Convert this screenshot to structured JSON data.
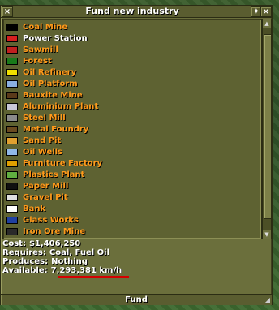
{
  "window": {
    "title": "Fund new industry",
    "close_icon": "close-x",
    "pin_icon": "pin",
    "fund_label": "Fund"
  },
  "industries": [
    {
      "label": "Coal Mine",
      "color": "#000000"
    },
    {
      "label": "Power Station",
      "color": "#d42020",
      "selected": true
    },
    {
      "label": "Sawmill",
      "color": "#c02020"
    },
    {
      "label": "Forest",
      "color": "#1a7a1a"
    },
    {
      "label": "Oil Refinery",
      "color": "#f0e000"
    },
    {
      "label": "Oil Platform",
      "color": "#8ab0e0"
    },
    {
      "label": "Bauxite Mine",
      "color": "#5a3a1a"
    },
    {
      "label": "Aluminium Plant",
      "color": "#c8c8d8"
    },
    {
      "label": "Steel Mill",
      "color": "#8a8a8a"
    },
    {
      "label": "Metal Foundry",
      "color": "#6a4a20"
    },
    {
      "label": "Sand Pit",
      "color": "#e0a030"
    },
    {
      "label": "Oil Wells",
      "color": "#90b8e8"
    },
    {
      "label": "Furniture Factory",
      "color": "#e0a000"
    },
    {
      "label": "Plastics Plant",
      "color": "#60b040"
    },
    {
      "label": "Paper Mill",
      "color": "#101010"
    },
    {
      "label": "Gravel Pit",
      "color": "#e0e0e0"
    },
    {
      "label": "Bank",
      "color": "#ffffff"
    },
    {
      "label": "Glass Works",
      "color": "#2040a0"
    },
    {
      "label": "Iron Ore Mine",
      "color": "#2a2a2a"
    }
  ],
  "info": {
    "cost_label": "Cost:",
    "cost_value": "$1,406,250",
    "requires_label": "Requires:",
    "requires_value": "Coal, Fuel Oil",
    "produces_label": "Produces:",
    "produces_value": "Nothing",
    "available_label": "Available:",
    "available_value": "7,293,381 km/h"
  }
}
